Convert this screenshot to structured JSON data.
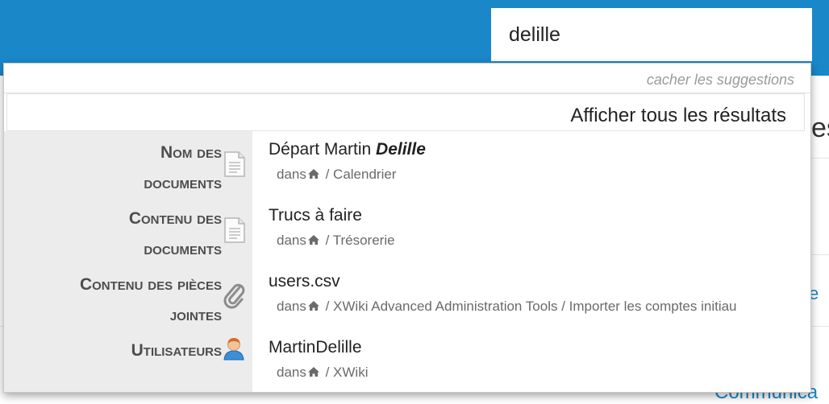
{
  "search": {
    "value": "delille"
  },
  "background": {
    "heading_fragment": "es",
    "link_fragment": "e",
    "bottom_link": "Communica"
  },
  "dropdown": {
    "hide_label": "cacher les suggestions",
    "show_all_label": "Afficher tous les résultats",
    "groups": [
      {
        "label_line1": "Nom des",
        "label_line2": "documents",
        "icon": "document-icon",
        "results": [
          {
            "title_plain": "Départ Martin ",
            "title_highlight": "Delille",
            "location_prefix": "dans",
            "location_path": " / Calendrier"
          }
        ]
      },
      {
        "label_line1": "Contenu des",
        "label_line2": "documents",
        "icon": "document-icon",
        "results": [
          {
            "title_plain": "Trucs à faire",
            "title_highlight": "",
            "location_prefix": "dans",
            "location_path": " / Trésorerie"
          }
        ]
      },
      {
        "label_line1": "Contenu des pièces",
        "label_line2": "jointes",
        "icon": "paperclip-icon",
        "results": [
          {
            "title_plain": "users.csv",
            "title_highlight": "",
            "location_prefix": "dans",
            "location_path": " / XWiki Advanced Administration Tools / Importer les comptes initiau"
          }
        ]
      },
      {
        "label_line1": "Utilisateurs",
        "label_line2": "",
        "icon": "user-icon",
        "results": [
          {
            "title_plain": "MartinDelille",
            "title_highlight": "",
            "location_prefix": "dans",
            "location_path": " / XWiki"
          }
        ]
      }
    ]
  },
  "colors": {
    "topbar": "#1a87c9",
    "left_column": "#ececec",
    "link": "#1a87c9"
  }
}
